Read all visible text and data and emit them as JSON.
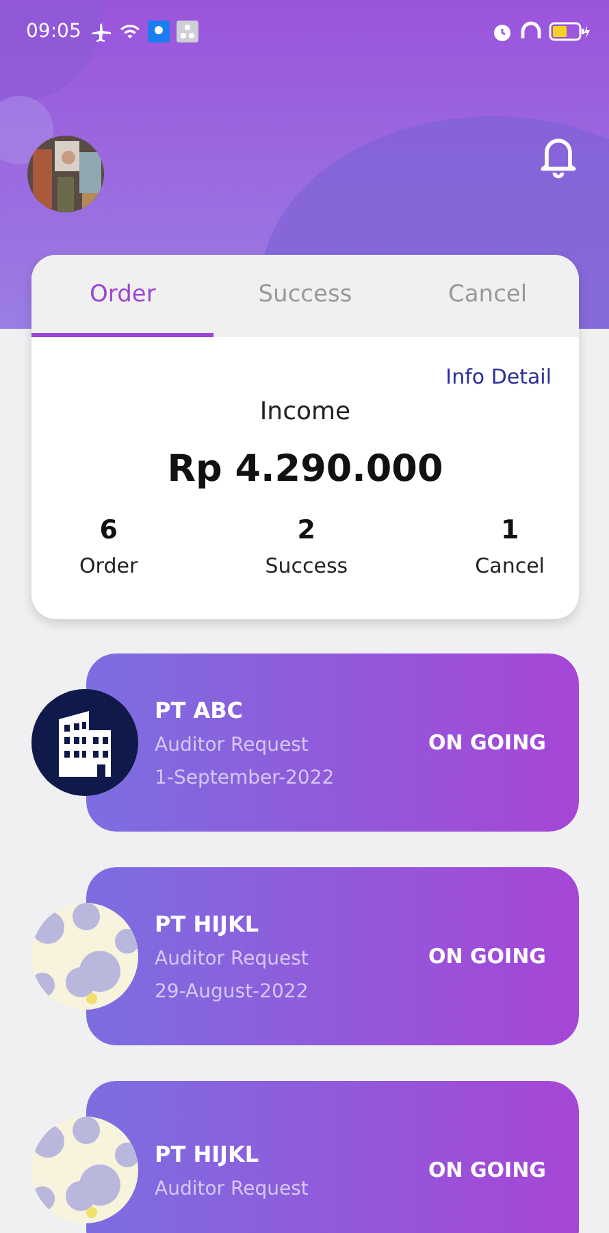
{
  "status_bar": {
    "time": "09:05"
  },
  "tabs": [
    {
      "label": "Order",
      "selected": true
    },
    {
      "label": "Success",
      "selected": false
    },
    {
      "label": "Cancel",
      "selected": false
    }
  ],
  "summary": {
    "link": "Info Detail",
    "title": "Income",
    "amount": "Rp 4.290.000",
    "stats": [
      {
        "value": "6",
        "label": "Order"
      },
      {
        "value": "2",
        "label": "Success"
      },
      {
        "value": "1",
        "label": "Cancel"
      }
    ]
  },
  "orders": [
    {
      "kind": "building",
      "company": "PT ABC",
      "type": "Auditor Request",
      "date": "1-September-2022",
      "status": "ON GOING"
    },
    {
      "kind": "picture",
      "company": "PT HIJKL",
      "type": "Auditor Request",
      "date": "29-August-2022",
      "status": "ON GOING"
    },
    {
      "kind": "picture",
      "company": "PT HIJKL",
      "type": "Auditor Request",
      "status": "ON GOING"
    }
  ]
}
